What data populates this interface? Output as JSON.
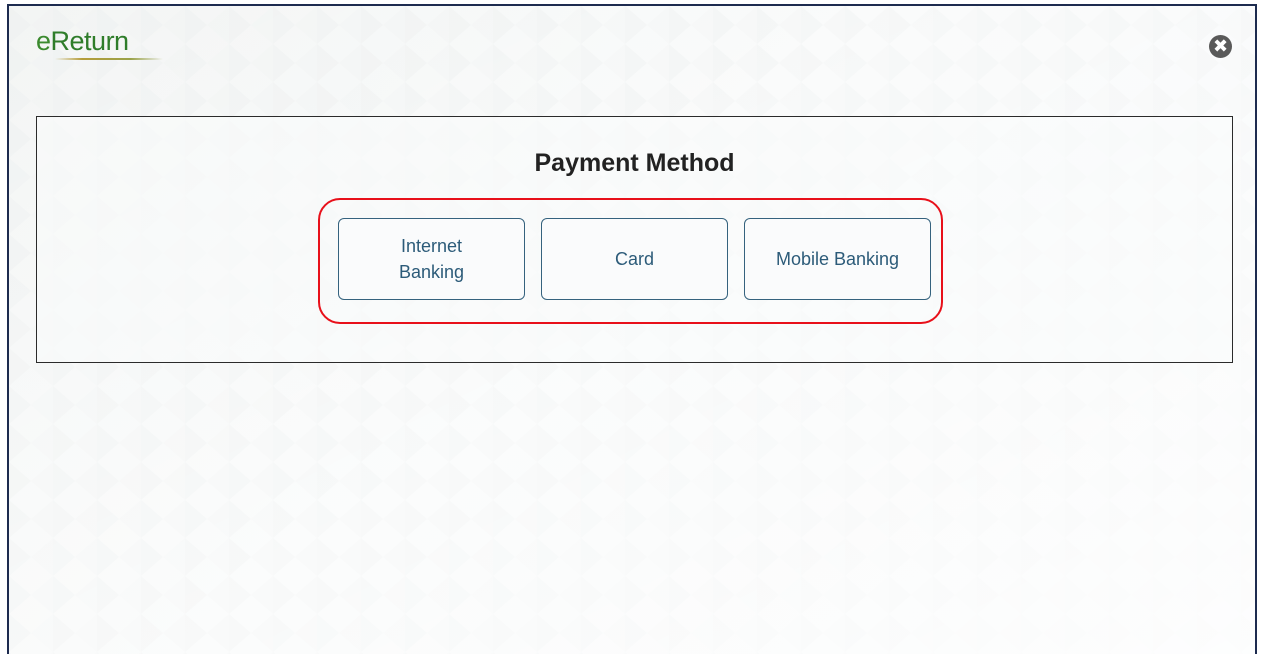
{
  "header": {
    "logo_e": "e",
    "logo_rest": "Return",
    "close_glyph": "✖"
  },
  "panel": {
    "title": "Payment Method",
    "methods": [
      {
        "label": "Internet Banking"
      },
      {
        "label": "Card"
      },
      {
        "label": "Mobile Banking"
      }
    ]
  },
  "colors": {
    "border": "#1d2b4f",
    "brand_green": "#2f7d2a",
    "button_border": "#35627e",
    "button_text": "#2c5b79",
    "highlight": "#e8101a"
  },
  "icons": {
    "close": "close-icon"
  }
}
